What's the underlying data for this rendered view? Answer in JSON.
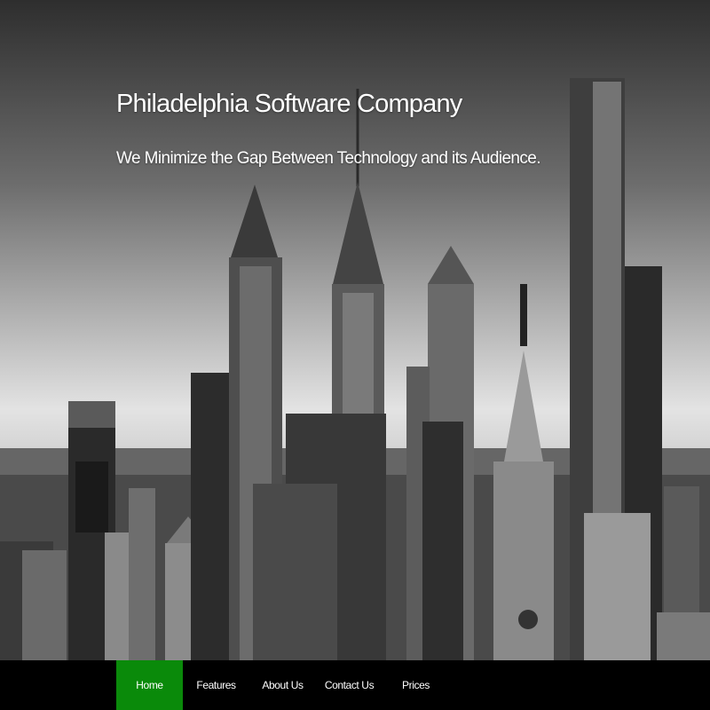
{
  "hero": {
    "title": "Philadelphia Software Company",
    "subtitle": "We Minimize the Gap Between Technology and its Audience.",
    "image_description_icon": "city-skyline-image"
  },
  "nav": {
    "items": [
      {
        "label": "Home",
        "active": true
      },
      {
        "label": "Features",
        "active": false
      },
      {
        "label": "About Us",
        "active": false
      },
      {
        "label": "Contact Us",
        "active": false
      },
      {
        "label": "Prices",
        "active": false
      }
    ]
  },
  "colors": {
    "nav_background": "#000000",
    "nav_active": "#0a8a0a",
    "text": "#ffffff"
  }
}
